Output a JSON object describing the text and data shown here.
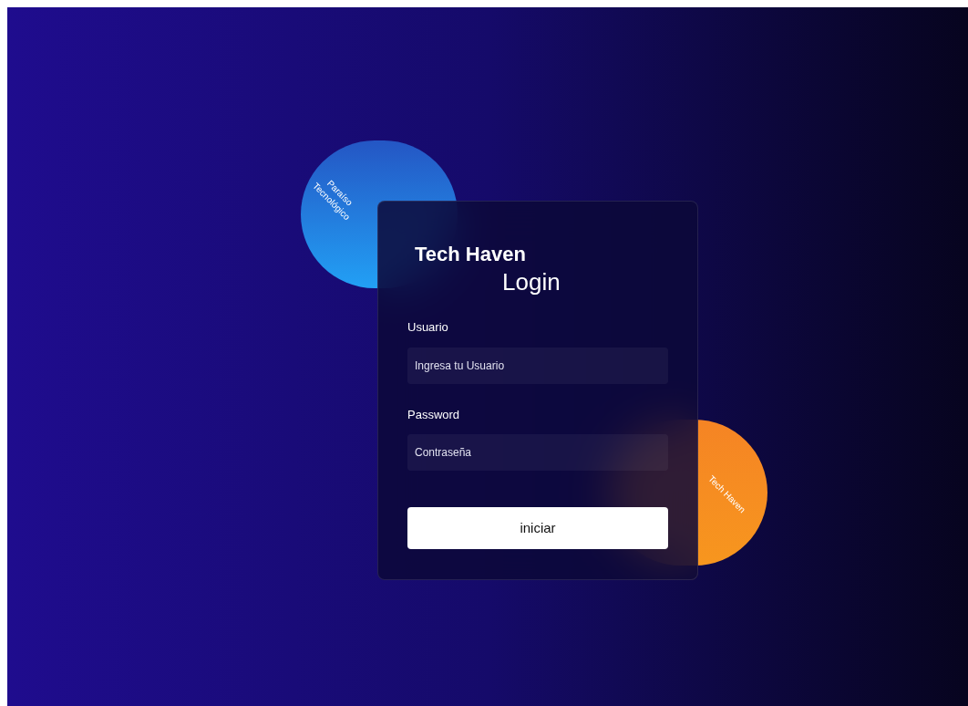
{
  "decorations": [
    {
      "kind": "blue",
      "text": "Paraíso Tecnológico"
    },
    {
      "kind": "orange",
      "text": "Tech Haven"
    }
  ],
  "brand": "Tech Haven",
  "title": "Login",
  "fields": [
    {
      "label": "Usuario",
      "placeholder": "Ingresa tu Usuario"
    },
    {
      "label": "Password",
      "placeholder": "Contraseña"
    }
  ],
  "button": "iniciar"
}
